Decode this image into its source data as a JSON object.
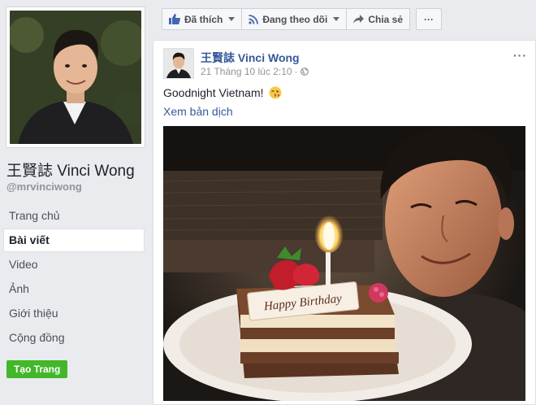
{
  "page": {
    "name": "王賢誌 Vinci Wong",
    "handle": "@mrvinciwong"
  },
  "nav": {
    "items": [
      {
        "label": "Trang chủ"
      },
      {
        "label": "Bài viết"
      },
      {
        "label": "Video"
      },
      {
        "label": "Ảnh"
      },
      {
        "label": "Giới thiệu"
      },
      {
        "label": "Cộng đồng"
      }
    ],
    "create_page": "Tạo Trang"
  },
  "actions": {
    "like": "Đã thích",
    "follow": "Đang theo dõi",
    "share": "Chia sẻ",
    "more": "···"
  },
  "post": {
    "author": "王賢誌 Vinci Wong",
    "timestamp": "21 Tháng 10 lúc 2:10",
    "privacy_icon": "globe-icon",
    "text": "Goodnight Vietnam!",
    "emoji": "😘",
    "translate": "Xem bản dịch",
    "menu": "···",
    "cake_writing": "Happy Birthday"
  },
  "colors": {
    "link": "#365899",
    "create_button": "#42b72a",
    "background": "#e9ebee"
  }
}
